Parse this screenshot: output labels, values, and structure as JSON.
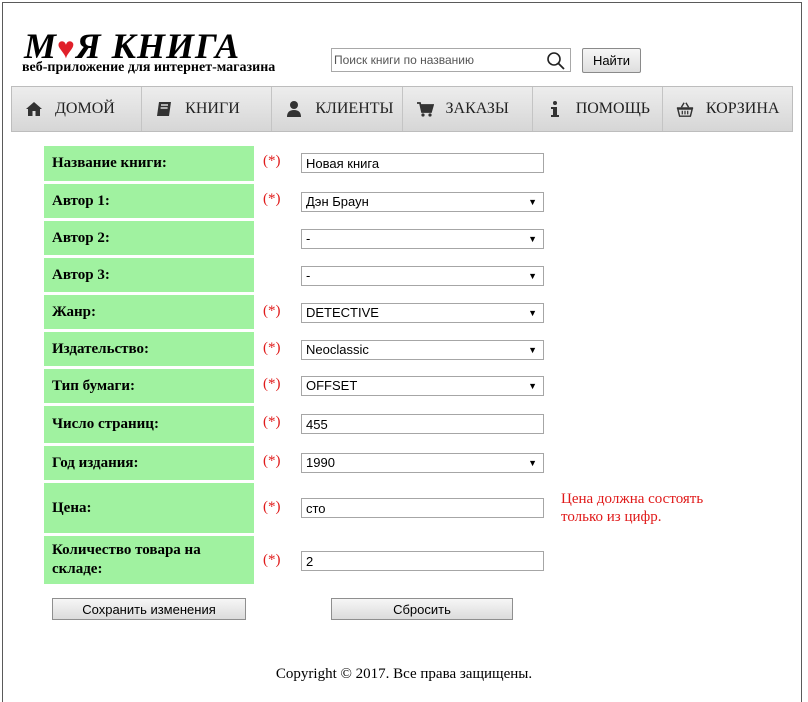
{
  "header": {
    "logo_title_part1": "М",
    "logo_title_heart": "♥",
    "logo_title_part2": "Я КНИГА",
    "logo_subtitle": "веб-приложение для интернет-магазина",
    "search_placeholder": "Поиск книги по названию",
    "search_button": "Найти"
  },
  "nav": {
    "items": [
      {
        "label": "ДОМОЙ",
        "icon": "home-icon"
      },
      {
        "label": "КНИГИ",
        "icon": "book-icon"
      },
      {
        "label": "КЛИЕНТЫ",
        "icon": "user-icon"
      },
      {
        "label": "ЗАКАЗЫ",
        "icon": "cart-icon"
      },
      {
        "label": "ПОМОЩЬ",
        "icon": "info-icon"
      },
      {
        "label": "КОРЗИНА",
        "icon": "basket-icon"
      }
    ]
  },
  "form": {
    "required_marker": "(*)",
    "fields": [
      {
        "label": "Название книги:",
        "value": "Новая книга",
        "type": "text",
        "required": true
      },
      {
        "label": "Автор 1:",
        "value": "Дэн Браун",
        "type": "select",
        "required": true
      },
      {
        "label": "Автор 2:",
        "value": "-",
        "type": "select",
        "required": false
      },
      {
        "label": "Автор 3:",
        "value": "-",
        "type": "select",
        "required": false
      },
      {
        "label": "Жанр:",
        "value": "DETECTIVE",
        "type": "select",
        "required": true
      },
      {
        "label": "Издательство:",
        "value": "Neoclassic",
        "type": "select",
        "required": true
      },
      {
        "label": "Тип бумаги:",
        "value": "OFFSET",
        "type": "select",
        "required": true
      },
      {
        "label": "Число страниц:",
        "value": "455",
        "type": "text",
        "required": true
      },
      {
        "label": "Год издания:",
        "value": "1990",
        "type": "select",
        "required": true
      },
      {
        "label": "Цена:",
        "value": "сто",
        "type": "text",
        "required": true,
        "error": "Цена должна состоять только из цифр."
      },
      {
        "label": "Количество товара на складе:",
        "value": "2",
        "type": "text",
        "required": true
      }
    ],
    "save_button": "Сохранить изменения",
    "reset_button": "Сбросить"
  },
  "footer": {
    "text": "Copyright © 2017. Все права защищены."
  },
  "colors": {
    "label_bg": "#a0f2a0",
    "required": "#e01a1a",
    "logo_heart": "#e0202a"
  }
}
